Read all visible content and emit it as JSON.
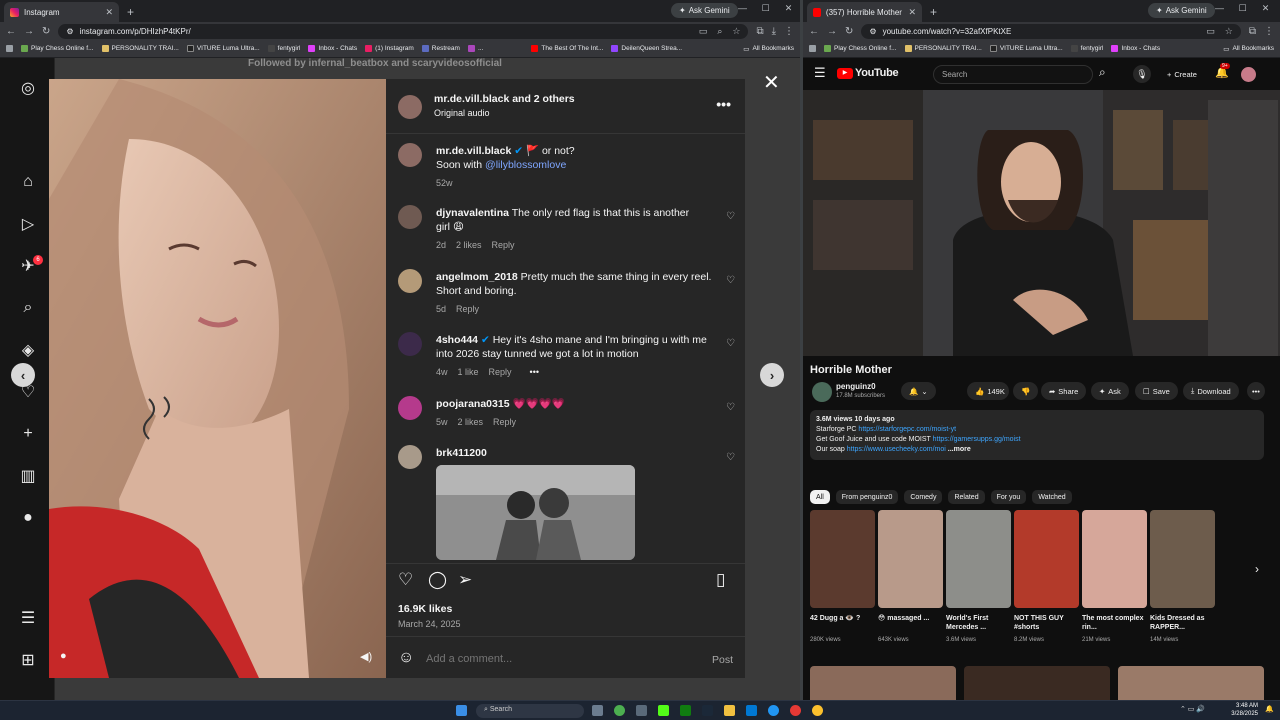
{
  "left_window": {
    "tab_title": "Instagram",
    "url": "instagram.com/p/DHIzhP4tKPr/",
    "gemini": "Ask Gemini",
    "bookmarks": [
      "Play Chess Online f...",
      "PERSONALITY TRAI...",
      "VITURE Luma Ultra...",
      "fentygirl",
      "Inbox - Chats",
      "(1) Instagram",
      "Restream",
      "...",
      "The Best Of The Int...",
      "DeilenQueen Strea..."
    ],
    "all_bookmarks": "All Bookmarks"
  },
  "instagram": {
    "notification_count": "6",
    "followed_by": "Followed by infernal_beatbox and scaryvideosofficial",
    "header": {
      "user": "mr.de.vill.black",
      "and_others": "and 2 others",
      "audio": "Original audio"
    },
    "caption": {
      "user": "mr.de.vill.black",
      "flag": "🚩 or not?",
      "line2_prefix": "Soon with",
      "mention": "@lilyblossomlove",
      "time": "52w"
    },
    "comments": [
      {
        "user": "djynavalentina",
        "text": "The only red flag is that this is another girl",
        "emoji": "😩",
        "time": "2d",
        "likes": "2 likes",
        "reply": "Reply"
      },
      {
        "user": "angelmom_2018",
        "text": "Pretty much the same thing in every reel.",
        "text2": "Short and boring.",
        "time": "5d",
        "reply": "Reply"
      },
      {
        "user": "4sho444",
        "text": "Hey it's 4sho mane and I'm bringing u with me",
        "text2": "into 2026 stay tunned we got a lot in motion",
        "time": "4w",
        "likes": "1 like",
        "reply": "Reply",
        "more": "•••"
      },
      {
        "user": "poojarana0315",
        "text": "💗💗💗💗",
        "time": "5w",
        "likes": "2 likes",
        "reply": "Reply"
      },
      {
        "user": "brk411200"
      }
    ],
    "likes": "16.9K likes",
    "date": "March 24, 2025",
    "comment_placeholder": "Add a comment...",
    "post_label": "Post"
  },
  "right_window": {
    "tab_title": "(357) Horrible Mother - YouTub",
    "url": "youtube.com/watch?v=32afXfPKtXE",
    "gemini": "Ask Gemini",
    "bookmarks": [
      "Play Chess Online f...",
      "PERSONALITY TRAI...",
      "VITURE Luma Ultra...",
      "fentygirl",
      "Inbox - Chats"
    ],
    "all_bookmarks": "All Bookmarks"
  },
  "youtube": {
    "logo": "YouTube",
    "search_placeholder": "Search",
    "create": "Create",
    "notif": "9+",
    "video_title": "Horrible Mother",
    "channel": "penguinz0",
    "subscribers": "17.8M subscribers",
    "likes": "149K",
    "share": "Share",
    "ask": "Ask",
    "save": "Save",
    "download": "Download",
    "desc": {
      "stats": "3.6M views  10 days ago",
      "l1": "Starforge PC",
      "l1_link": "https://starforgepc.com/moist-yt",
      "l2": "Get Goof Juice and use code MOIST",
      "l2_link": "https://gamersupps.gg/moist",
      "l3": "Our soap",
      "l3_link": "https://www.usecheeky.com/moi",
      "more": "...more"
    },
    "chips": [
      "All",
      "From penguinz0",
      "Comedy",
      "Related",
      "For you",
      "Watched"
    ],
    "related": [
      {
        "title": "42 Dugg a 👁️ ?",
        "views": "280K views",
        "color": "#5b3a2e"
      },
      {
        "title": "😳 massaged ...",
        "views": "643K views",
        "color": "#b89a8a"
      },
      {
        "title": "World's First Mercedes ...",
        "views": "3.6M views",
        "color": "#8d8e8a"
      },
      {
        "title": "NOT THIS GUY #shorts",
        "views": "8.2M views",
        "color": "#b33a2a"
      },
      {
        "title": "The most complex rin...",
        "views": "21M views",
        "color": "#d6a79a"
      },
      {
        "title": "Kids Dressed as RAPPER...",
        "views": "14M views",
        "color": "#6d5c4c"
      }
    ]
  },
  "taskbar": {
    "search": "Search",
    "time": "3:48 AM",
    "date": "3/28/2025"
  }
}
